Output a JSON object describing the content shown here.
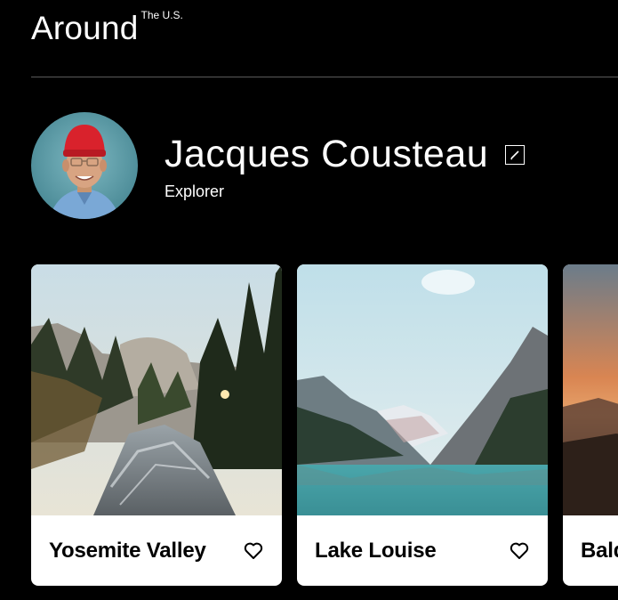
{
  "header": {
    "logo_main": "Around",
    "logo_sup": "The U.S."
  },
  "profile": {
    "name": "Jacques Cousteau",
    "role": "Explorer"
  },
  "cards": [
    {
      "title": "Yosemite Valley",
      "like_icon": "heart-outline-icon"
    },
    {
      "title": "Lake Louise",
      "like_icon": "heart-outline-icon"
    },
    {
      "title": "Bald Mountains",
      "like_icon": "heart-outline-icon"
    }
  ],
  "colors": {
    "background": "#000000",
    "text": "#ffffff",
    "card_background": "#ffffff",
    "card_text": "#000000",
    "divider": "#5a5a5a"
  }
}
